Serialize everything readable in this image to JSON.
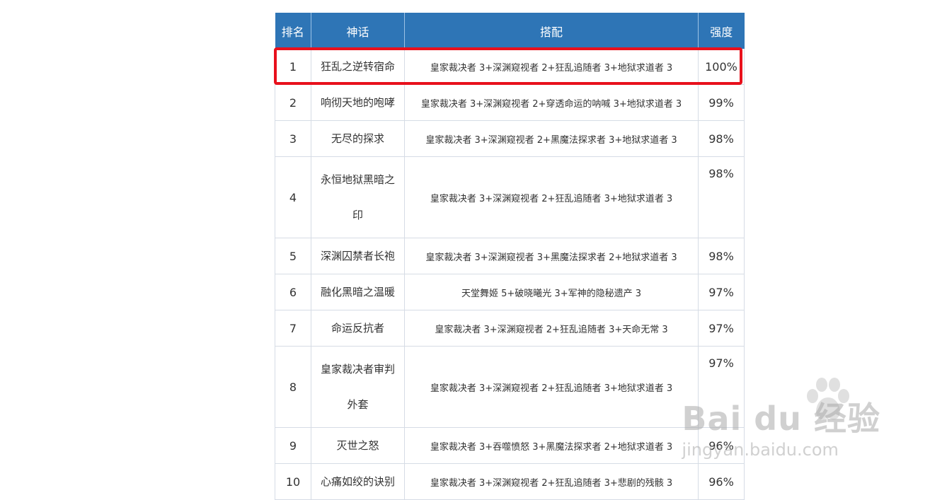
{
  "table": {
    "headers": [
      "排名",
      "神话",
      "搭配",
      "强度"
    ],
    "rows": [
      {
        "rank": "1",
        "myth": "狂乱之逆转宿命",
        "combo": "皇家裁决者 3+深渊窥视者 2+狂乱追随者 3+地狱求道者 3",
        "power": "100%"
      },
      {
        "rank": "2",
        "myth": "响彻天地的咆哮",
        "combo": "皇家裁决者 3+深渊窥视者 2+穿透命运的呐喊 3+地狱求道者 3",
        "power": "99%"
      },
      {
        "rank": "3",
        "myth": "无尽的探求",
        "combo": "皇家裁决者 3+深渊窥视者 2+黑魔法探求者 3+地狱求道者 3",
        "power": "98%"
      },
      {
        "rank": "4",
        "myth": "永恒地狱黑暗之印",
        "combo": "皇家裁决者 3+深渊窥视者 2+狂乱追随者 3+地狱求道者 3",
        "power": "98%"
      },
      {
        "rank": "5",
        "myth": "深渊囚禁者长袍",
        "combo": "皇家裁决者 3+深渊窥视者 3+黑魔法探求者 2+地狱求道者 3",
        "power": "98%"
      },
      {
        "rank": "6",
        "myth": "融化黑暗之温暖",
        "combo": "天堂舞姬 5+破晓曦光 3+军神的隐秘遗产 3",
        "power": "97%"
      },
      {
        "rank": "7",
        "myth": "命运反抗者",
        "combo": "皇家裁决者 3+深渊窥视者 2+狂乱追随者 3+天命无常 3",
        "power": "97%"
      },
      {
        "rank": "8",
        "myth": "皇家裁决者审判外套",
        "combo": "皇家裁决者 3+深渊窥视者 2+狂乱追随者 3+地狱求道者 3",
        "power": "97%"
      },
      {
        "rank": "9",
        "myth": "灭世之怒",
        "combo": "皇家裁决者 3+吞噬愤怒 3+黑魔法探求者 2+地狱求道者 3",
        "power": "96%"
      },
      {
        "rank": "10",
        "myth": "心痛如绞的诀别",
        "combo": "皇家裁决者 3+深渊窥视者 2+狂乱追随者 3+悲剧的残骸 3",
        "power": "96%"
      }
    ]
  },
  "watermark": {
    "main": "Bai du 经验",
    "sub": "jingyan.baidu.com"
  },
  "colors": {
    "header_bg": "#2e75b6",
    "highlight": "#e8101c"
  }
}
